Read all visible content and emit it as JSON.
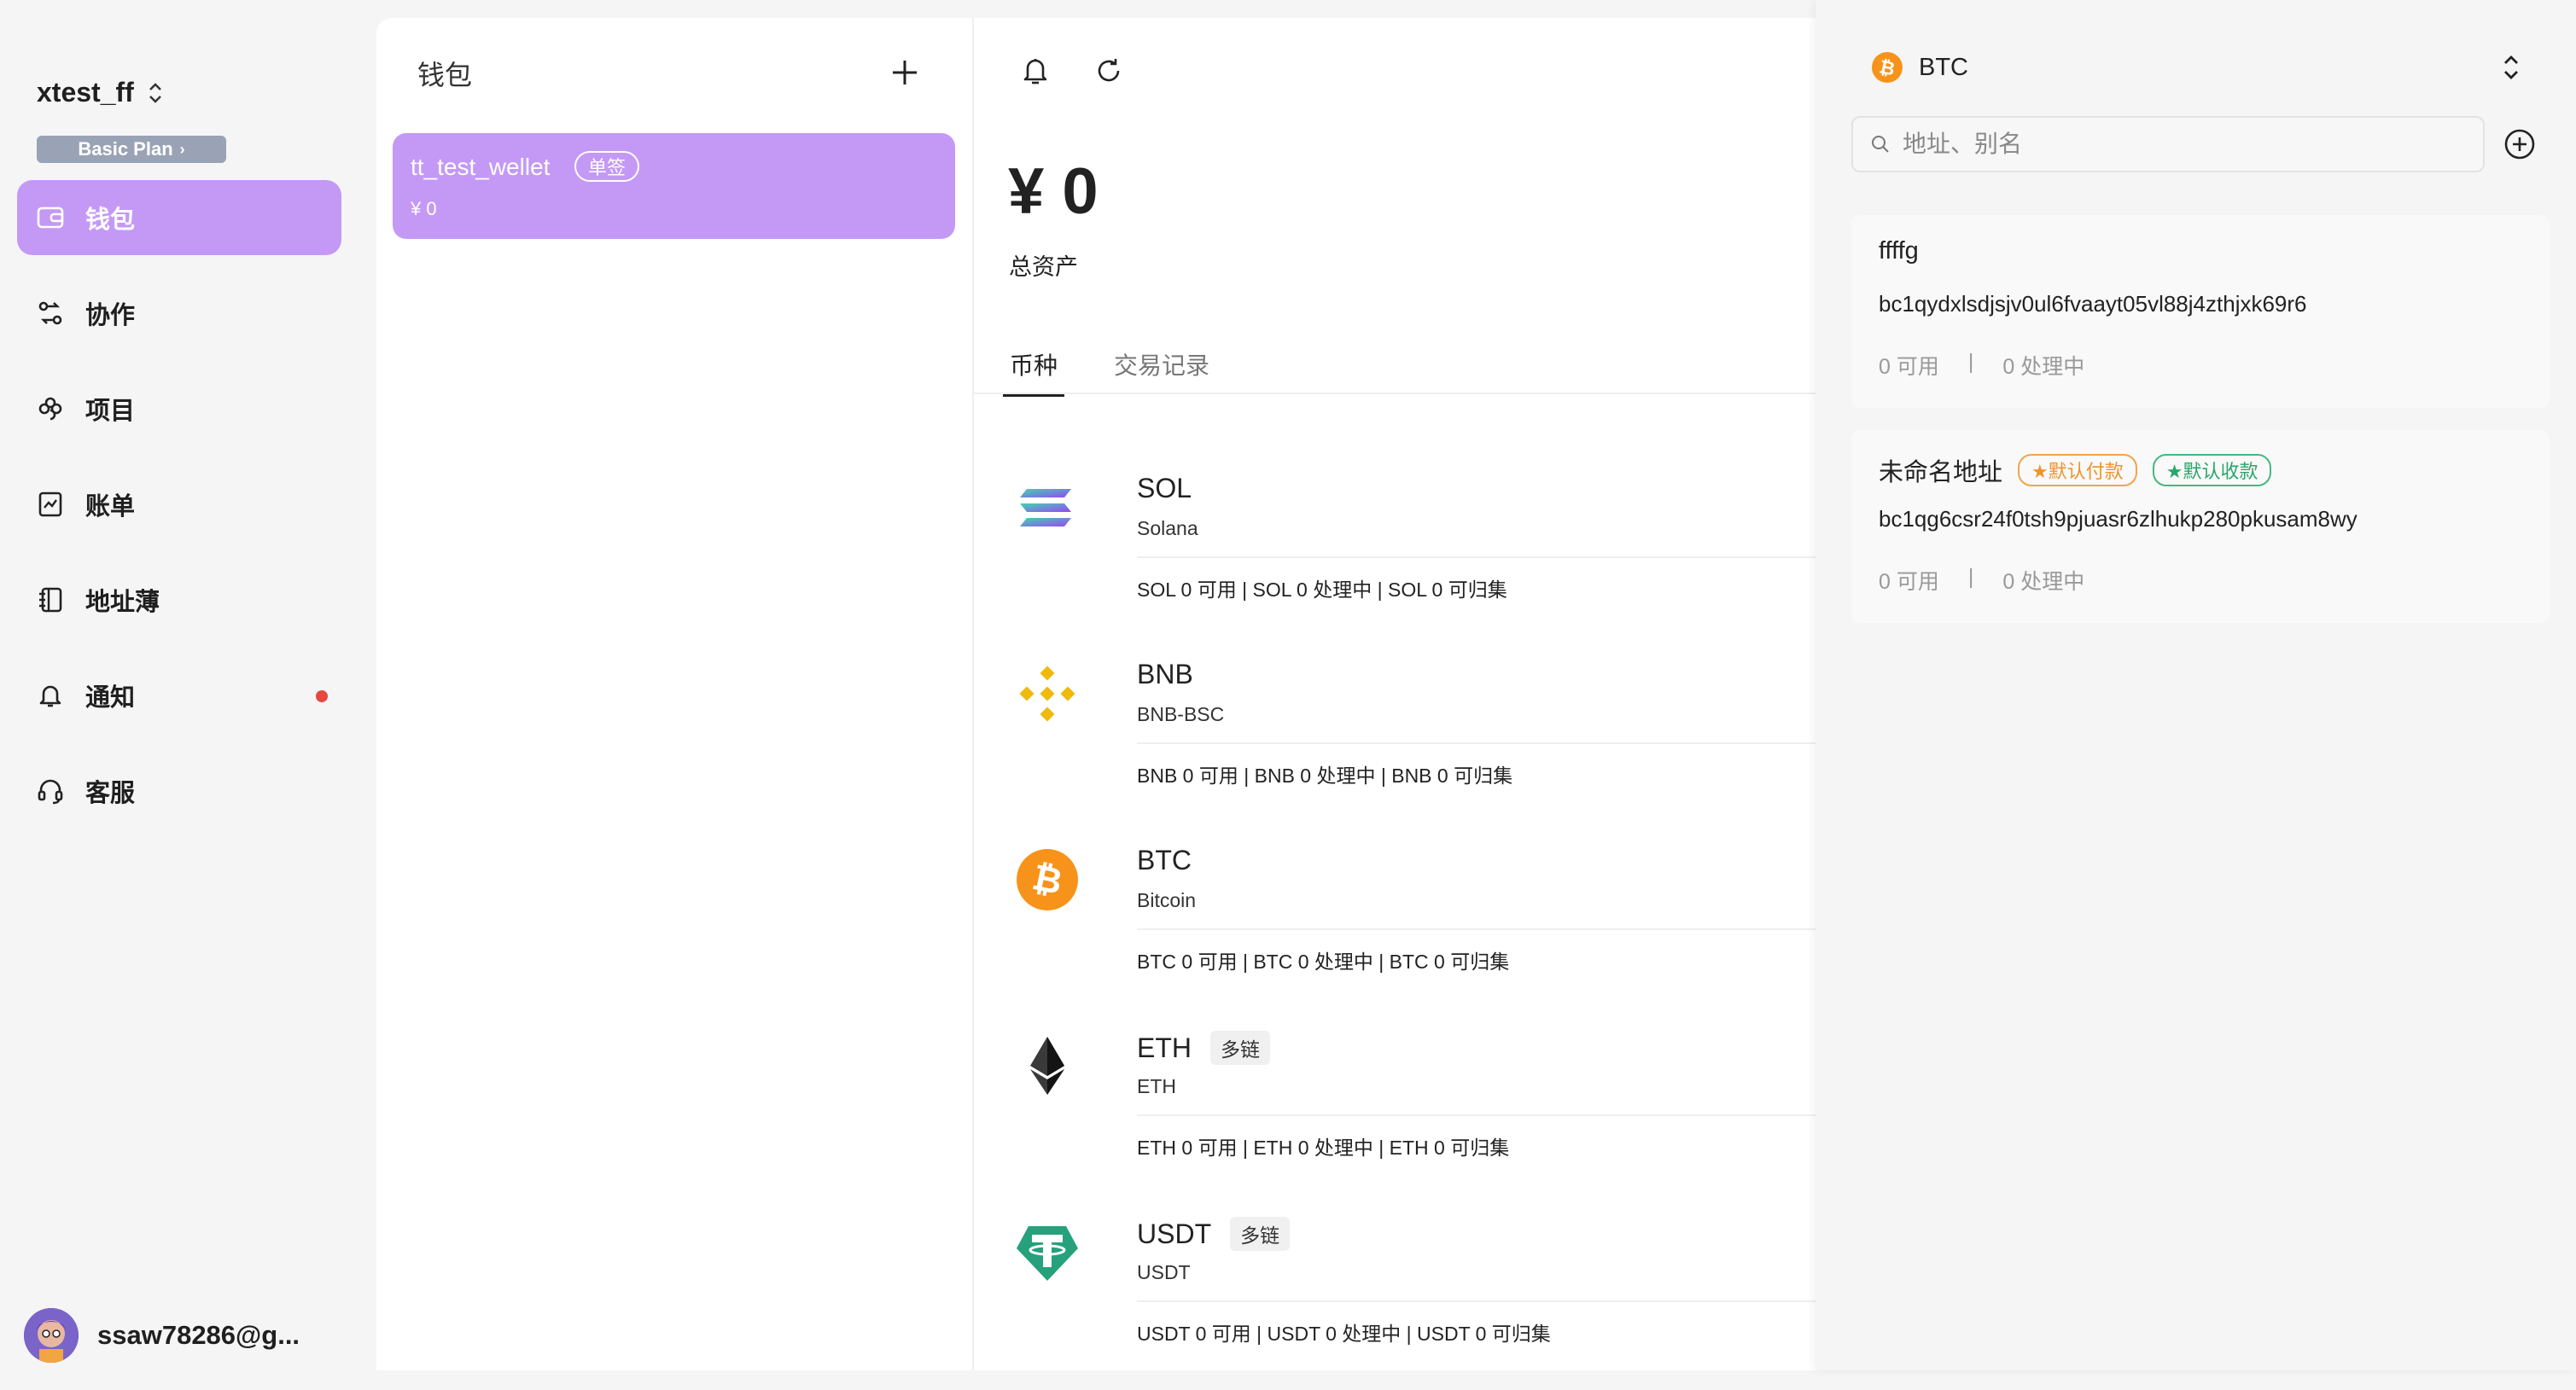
{
  "sidebar": {
    "org_name": "xtest_ff",
    "plan": "Basic Plan",
    "items": [
      {
        "label": "钱包"
      },
      {
        "label": "协作"
      },
      {
        "label": "项目"
      },
      {
        "label": "账单"
      },
      {
        "label": "地址薄"
      },
      {
        "label": "通知"
      },
      {
        "label": "客服"
      }
    ],
    "user": "ssaw78286@g..."
  },
  "wallets": {
    "title": "钱包",
    "items": [
      {
        "name": "tt_test_wellet",
        "tag": "单签",
        "balance": "¥ 0"
      }
    ]
  },
  "main": {
    "total": "¥ 0",
    "total_label": "总资产",
    "tabs": [
      "币种",
      "交易记录"
    ],
    "coins": [
      {
        "symbol": "SOL",
        "name": "Solana",
        "chip": "",
        "stats": "SOL 0 可用  |  SOL 0 处理中  |  SOL 0 可归集"
      },
      {
        "symbol": "BNB",
        "name": "BNB-BSC",
        "chip": "",
        "stats": "BNB 0 可用  |  BNB 0 处理中  |  BNB 0 可归集"
      },
      {
        "symbol": "BTC",
        "name": "Bitcoin",
        "chip": "",
        "stats": "BTC 0 可用  |  BTC 0 处理中  |  BTC 0 可归集"
      },
      {
        "symbol": "ETH",
        "name": "ETH",
        "chip": "多链",
        "stats": "ETH 0 可用  |  ETH 0 处理中  |  ETH 0 可归集"
      },
      {
        "symbol": "USDT",
        "name": "USDT",
        "chip": "多链",
        "stats": "USDT 0 可用  |  USDT 0 处理中  |  USDT 0 可归集"
      }
    ]
  },
  "drawer": {
    "coin": "BTC",
    "search_placeholder": "地址、别名",
    "addresses": [
      {
        "name": "ffffg",
        "address": "bc1qydxlsdjsjv0ul6fvaayt05vl88j4zthjxk69r6",
        "available": "0 可用",
        "processing": "0 处理中",
        "sep": "|",
        "badge_pay": "",
        "badge_recv": ""
      },
      {
        "name": "未命名地址",
        "address": "bc1qg6csr24f0tsh9pjuasr6zlhukp280pkusam8wy",
        "available": "0 可用",
        "processing": "0 处理中",
        "sep": "|",
        "badge_pay": "★默认付款",
        "badge_recv": "★默认收款"
      }
    ]
  },
  "colors": {
    "accent": "#c499f6",
    "notify_dot": "#e5483f",
    "btc": "#f7931a",
    "usdt": "#26a17b",
    "bnb": "#f0b90b"
  }
}
